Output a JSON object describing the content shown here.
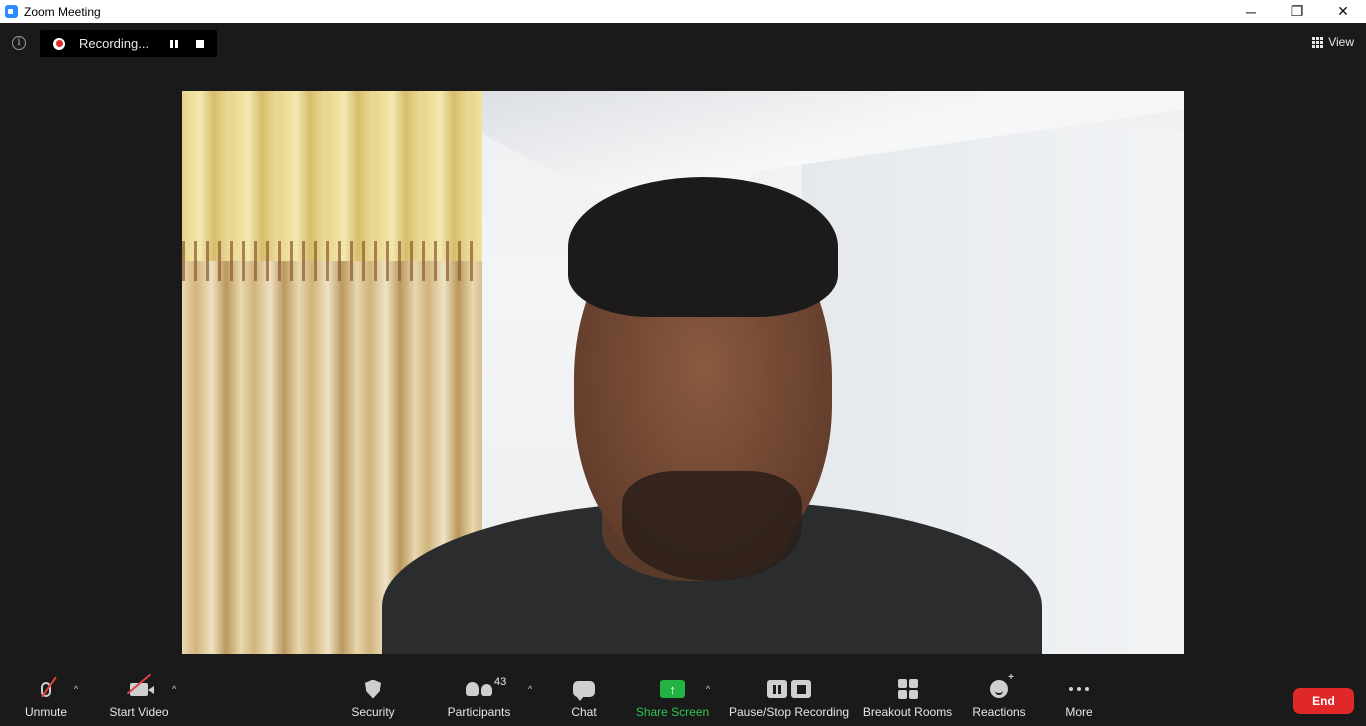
{
  "window": {
    "title": "Zoom Meeting",
    "minimize_glyph": "─",
    "restore_glyph": "❐",
    "close_glyph": "✕"
  },
  "topbar": {
    "info_glyph": "i",
    "recording_label": "Recording...",
    "view_label": "View"
  },
  "video": {
    "participant_feed": "webcam-video"
  },
  "toolbar": {
    "unmute_label": "Unmute",
    "start_video_label": "Start Video",
    "security_label": "Security",
    "participants_label": "Participants",
    "participants_count": "43",
    "chat_label": "Chat",
    "share_screen_label": "Share Screen",
    "share_screen_glyph": "↑",
    "recording_label": "Pause/Stop Recording",
    "breakout_label": "Breakout Rooms",
    "reactions_label": "Reactions",
    "more_label": "More",
    "end_label": "End",
    "caret_glyph": "^"
  },
  "colors": {
    "accent": "#2d8cff",
    "end_red": "#e02828",
    "share_green": "#23b342",
    "mute_slash": "#e24141"
  }
}
